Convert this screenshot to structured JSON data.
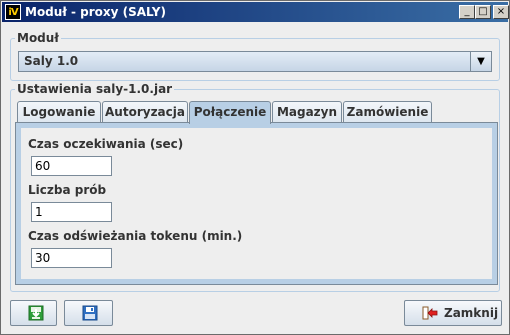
{
  "window": {
    "app_icon": "iV",
    "title": "Moduł - proxy (SALY)",
    "minimize_glyph": "_",
    "maximize_glyph": "□",
    "close_glyph": "×",
    "titlebar_color": "#0a246a"
  },
  "module": {
    "group_title": "Moduł",
    "selected": "Saly 1.0",
    "dropdown_glyph": "▼"
  },
  "settings": {
    "group_title": "Ustawienia saly-1.0.jar",
    "tabs": [
      {
        "label": "Logowanie",
        "active": false
      },
      {
        "label": "Autoryzacja",
        "active": false
      },
      {
        "label": "Połączenie",
        "active": true
      },
      {
        "label": "Magazyn",
        "active": false
      },
      {
        "label": "Zamówienie",
        "active": false
      }
    ],
    "fields": [
      {
        "label": "Czas oczekiwania (sec)",
        "value": "60"
      },
      {
        "label": "Liczba prób",
        "value": "1"
      },
      {
        "label": "Czas odświeżania tokenu (min.)",
        "value": "30"
      }
    ]
  },
  "buttons": {
    "download_icon": "download-icon",
    "save_icon": "floppy-icon",
    "close_label": "Zamknij",
    "close_icon": "exit-icon"
  },
  "colors": {
    "accent": "#b8cfe5",
    "border": "#7a8a99",
    "background": "#eeeeee"
  }
}
